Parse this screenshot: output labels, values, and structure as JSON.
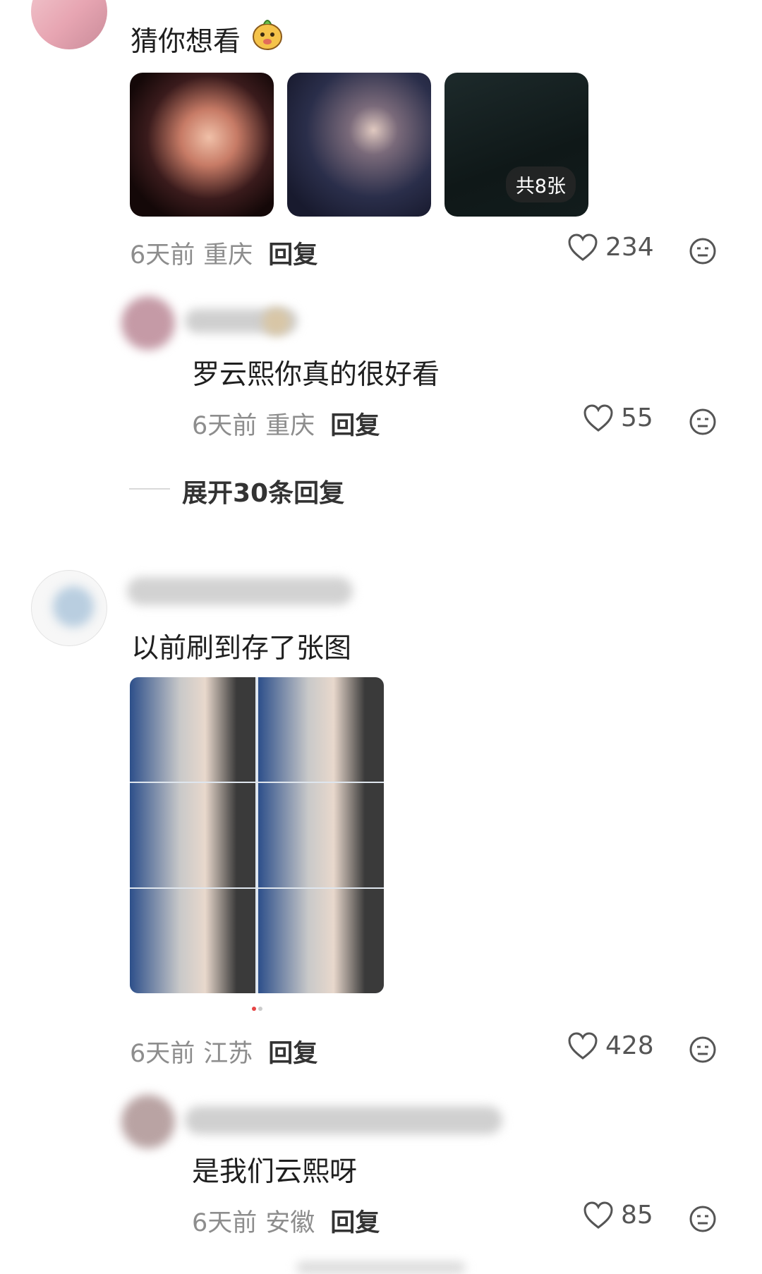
{
  "comments": [
    {
      "text": "猜你想看",
      "emoji": "face-sticker-icon",
      "images": {
        "badge": "共8张"
      },
      "meta": {
        "time": "6天前",
        "location": "重庆",
        "reply": "回复"
      },
      "likes": "234"
    },
    {
      "text": "罗云熙你真的很好看",
      "meta": {
        "time": "6天前",
        "location": "重庆",
        "reply": "回复"
      },
      "likes": "55"
    },
    {
      "expand_label": "展开30条回复"
    },
    {
      "text": "以前刷到存了张图",
      "meta": {
        "time": "6天前",
        "location": "江苏",
        "reply": "回复"
      },
      "likes": "428"
    },
    {
      "text": "是我们云熙呀",
      "meta": {
        "time": "6天前",
        "location": "安徽",
        "reply": "回复"
      },
      "likes": "85"
    }
  ],
  "colors": {
    "accent": "#e64545",
    "meta_gray": "#8d8d8d"
  }
}
